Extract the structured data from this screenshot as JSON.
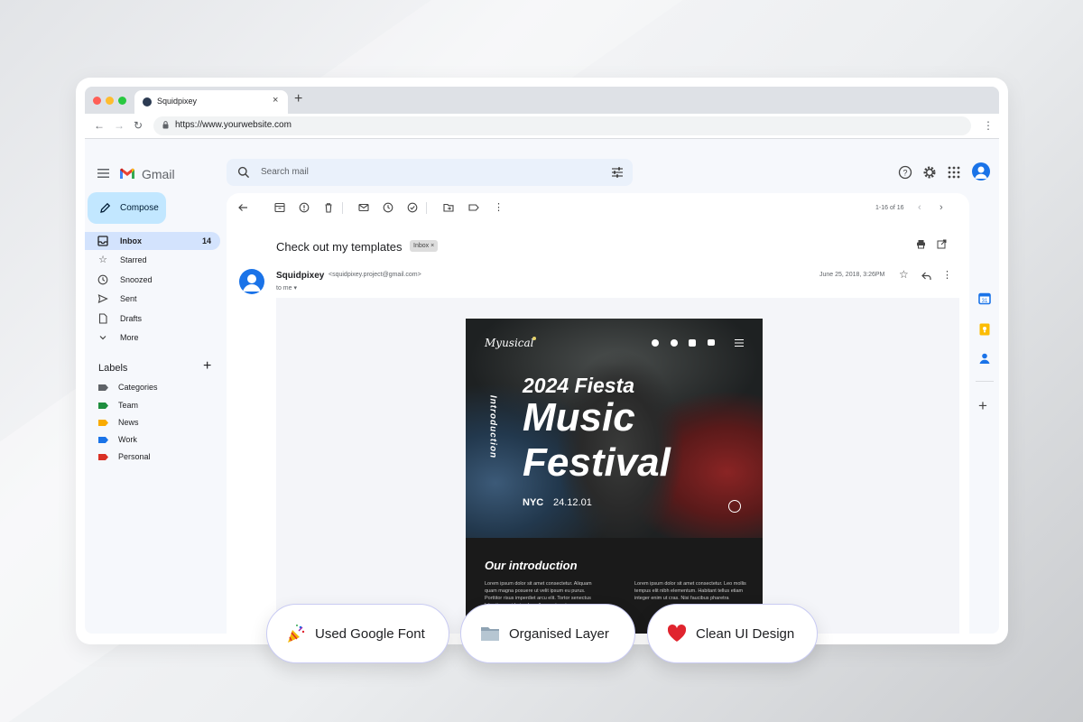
{
  "browser": {
    "tab_title": "Squidpixey",
    "tab_close": "×",
    "new_tab": "+",
    "url": "https://www.yourwebsite.com",
    "icons": [
      "back-icon",
      "forward-icon",
      "reload-icon",
      "lock-icon",
      "more-icon"
    ]
  },
  "gmail": {
    "brand": "Gmail",
    "search_placeholder": "Search mail",
    "compose_label": "Compose",
    "nav": [
      {
        "label": "Inbox",
        "count": "14",
        "icon": "inbox-icon",
        "active": true
      },
      {
        "label": "Starred",
        "count": "",
        "icon": "star-icon"
      },
      {
        "label": "Snoozed",
        "count": "",
        "icon": "clock-icon"
      },
      {
        "label": "Sent",
        "count": "",
        "icon": "send-icon"
      },
      {
        "label": "Drafts",
        "count": "",
        "icon": "draft-icon"
      },
      {
        "label": "More",
        "count": "",
        "icon": "chevron-down-icon"
      }
    ],
    "labels_heading": "Labels",
    "labels": [
      {
        "label": "Categories",
        "color": "#5f6368"
      },
      {
        "label": "Team",
        "color": "#1e8e3e"
      },
      {
        "label": "News",
        "color": "#f9ab00"
      },
      {
        "label": "Work",
        "color": "#1a73e8"
      },
      {
        "label": "Personal",
        "color": "#d93025"
      }
    ],
    "pager": "1-16 of 16"
  },
  "email": {
    "subject": "Check out my templates",
    "chip": "Inbox ×",
    "sender_name": "Squidpixey",
    "sender_email": "<squidpixey.project@gmail.com>",
    "to": "to me",
    "date": "June 25, 2018, 3:26PM"
  },
  "poster": {
    "logo": "Myusical",
    "vertical_label": "Introduction",
    "line1": "2024 Fiesta",
    "line2": "Music",
    "line3": "Festival",
    "city": "NYC",
    "event_date": "24.12.01",
    "section_title": "Our introduction",
    "para_left": "Lorem ipsum dolor sit amet consectetur. Aliquam quam magna posuere ut velit ipsum eu purus. Porttitor risus imperdiet arcu elit. Tortor senectus lobortis gravida in phasellus auctor et",
    "para_right": "Lorem ipsum dolor sit amet consectetur. Leo mollis tempus elit nibh elementum. Habitant tellus etiam integer enim ut cras. Nisi faucibus pharetra"
  },
  "features": [
    {
      "label": "Used Google Font",
      "icon": "party-popper-icon"
    },
    {
      "label": "Organised Layer",
      "icon": "folder-icon"
    },
    {
      "label": "Clean UI Design",
      "icon": "heart-icon"
    }
  ],
  "colors": {
    "accent": "#1a73e8",
    "compose_bg": "#c2e7ff",
    "active_nav": "#d3e3fd",
    "heart": "#e0242e"
  }
}
